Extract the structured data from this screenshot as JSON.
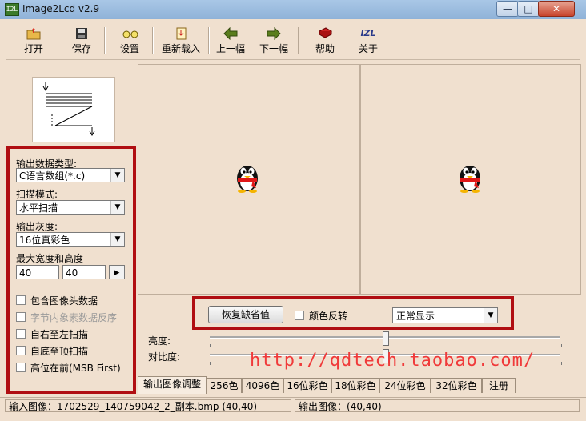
{
  "window": {
    "title": "Image2Lcd v2.9",
    "icon_text": "I2L",
    "controls": {
      "minimize": "—",
      "maximize": "□",
      "close": "✕"
    }
  },
  "toolbar": {
    "open": "打开",
    "save": "保存",
    "settings": "设置",
    "reload": "重新载入",
    "prev": "上一幅",
    "next": "下一幅",
    "help": "帮助",
    "about": "关于",
    "about_icon": "IZL"
  },
  "left_panel": {
    "output_type_label": "输出数据类型:",
    "output_type_value": "C语言数组(*.c)",
    "scan_mode_label": "扫描模式:",
    "scan_mode_value": "水平扫描",
    "gray_label": "输出灰度:",
    "gray_value": "16位真彩色",
    "maxsize_label": "最大宽度和高度",
    "width_value": "40",
    "height_value": "40",
    "checkboxes": {
      "include_header": "包含图像头数据",
      "byte_reverse": "字节内象素数据反序",
      "right_to_left": "自右至左扫描",
      "bottom_to_top": "自底至顶扫描",
      "msb_first": "高位在前(MSB First)"
    }
  },
  "adjust": {
    "restore_default": "恢复缺省值",
    "invert_color": "颜色反转",
    "display_mode": "正常显示",
    "brightness_label": "亮度:",
    "contrast_label": "对比度:",
    "brightness_level": 0.5,
    "contrast_level": 0.5
  },
  "watermark": "http://qdtech.taobao.com/",
  "tabs": [
    "输出图像调整",
    "256色",
    "4096色",
    "16位彩色",
    "18位彩色",
    "24位彩色",
    "32位彩色",
    "注册"
  ],
  "status": {
    "input": "输入图像：1702529_140759042_2_副本.bmp (40,40)",
    "output": "输出图像：(40,40)"
  },
  "colors": {
    "highlight_border": "#b00e12",
    "window_bg": "#f0e0cf",
    "watermark": "#f03a3a"
  }
}
